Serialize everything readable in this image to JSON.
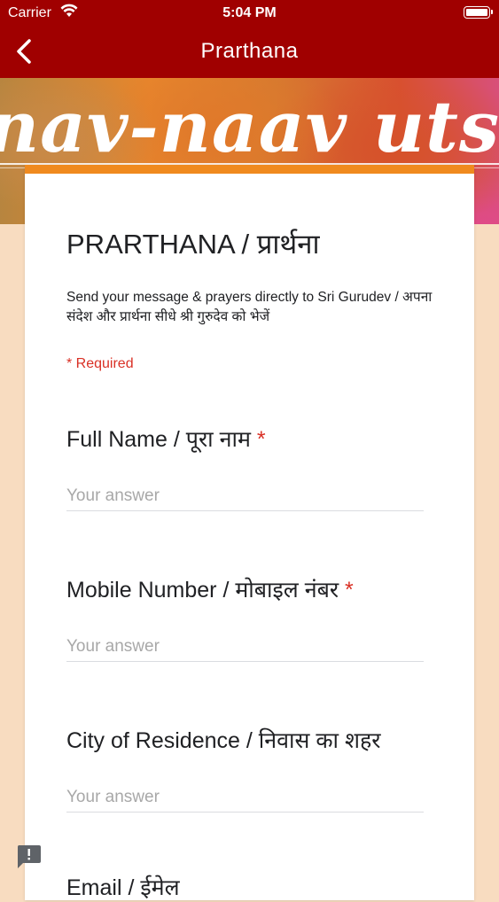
{
  "status_bar": {
    "carrier": "Carrier",
    "time": "5:04 PM"
  },
  "nav": {
    "title": "Prarthana",
    "back_icon": "chevron-left-icon"
  },
  "banner": {
    "text": "nav-naav utsav"
  },
  "form": {
    "title": "PRARTHANA / प्रार्थना",
    "description": "Send your message & prayers directly to Sri Gurudev / अपना संदेश और प्रार्थना सीधे श्री गुरुदेव को भेजें",
    "required_note": "* Required",
    "questions": [
      {
        "label": "Full Name / पूरा नाम",
        "required": "*",
        "placeholder": "Your answer"
      },
      {
        "label": "Mobile Number / मोबाइल नंबर",
        "required": "*",
        "placeholder": "Your answer"
      },
      {
        "label": "City of Residence / निवास का शहर",
        "placeholder": "Your answer"
      },
      {
        "label": "Email / ईमेल"
      }
    ]
  },
  "colors": {
    "header": "#a00000",
    "card_accent": "#f08a1e",
    "required": "#d93025",
    "page_bg": "#f8dcc0"
  },
  "feedback_icon": "report-feedback-icon"
}
